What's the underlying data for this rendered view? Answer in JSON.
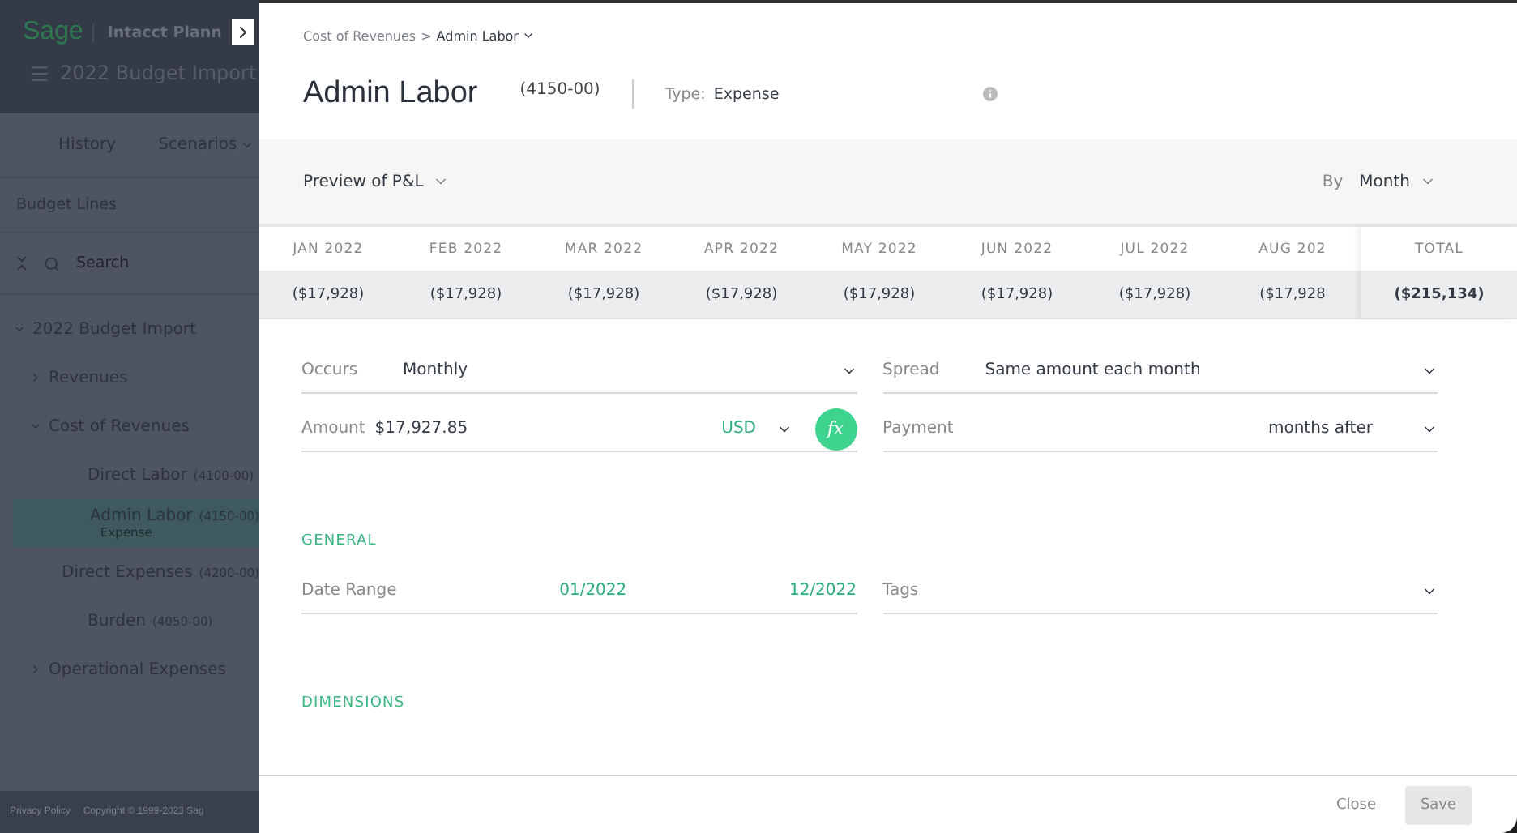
{
  "sidebar": {
    "logo": "Sage",
    "product": "Intacct Plann",
    "plan_title": "2022 Budget Import",
    "tabs": [
      {
        "label": "History",
        "selected": false,
        "has_menu": false
      },
      {
        "label": "Scenarios",
        "selected": false,
        "has_menu": true
      }
    ],
    "section_title": "Budget Lines",
    "search": {
      "placeholder": "Search"
    },
    "tree": [
      {
        "label": "2022 Budget Import",
        "expanded": true,
        "children": [
          {
            "label": "Revenues",
            "expanded": false
          },
          {
            "label": "Cost of Revenues",
            "expanded": true,
            "children": [
              {
                "label": "Direct Labor",
                "code": "(4100-00)",
                "selected": false
              },
              {
                "label": "Admin Labor",
                "code": "(4150-00)",
                "subtitle": "Expense",
                "selected": true
              },
              {
                "label": "Direct Expenses",
                "code": "(4200-00)",
                "selected": false
              },
              {
                "label": "Burden",
                "code": "(4050-00)",
                "selected": false
              }
            ]
          },
          {
            "label": "Operational Expenses",
            "expanded": false
          }
        ]
      }
    ],
    "footer": [
      "Privacy Policy",
      "Copyright © 1999-2023 Sag"
    ]
  },
  "panel": {
    "breadcrumb": {
      "parent": "Cost of Revenues",
      "separator": ">",
      "current": "Admin Labor"
    },
    "title": "Admin Labor",
    "code": "(4150-00)",
    "type_label": "Type:",
    "type_value": "Expense",
    "preview": {
      "label": "Preview of P&L",
      "by_label": "By",
      "by_value": "Month"
    },
    "table": {
      "columns": [
        "JAN 2022",
        "FEB 2022",
        "MAR 2022",
        "APR 2022",
        "MAY 2022",
        "JUN 2022",
        "JUL 2022",
        "AUG 202"
      ],
      "values": [
        "($17,928)",
        "($17,928)",
        "($17,928)",
        "($17,928)",
        "($17,928)",
        "($17,928)",
        "($17,928)",
        "($17,928"
      ],
      "total_label": "TOTAL",
      "total_value": "($215,134)"
    },
    "fields": [
      {
        "kind": "select",
        "label": "Occurs",
        "value": "Monthly"
      },
      {
        "kind": "select",
        "label": "Spread",
        "value": "Same amount each month"
      },
      {
        "kind": "amount",
        "label": "Amount",
        "value": "$17,927.85",
        "currency": "USD",
        "formula_label": "fx"
      },
      {
        "kind": "trailing",
        "label": "Payment",
        "value": "months after"
      }
    ],
    "sections": [
      {
        "title": "GENERAL",
        "fields": [
          {
            "kind": "range",
            "label": "Date Range",
            "start": "01/2022",
            "end": "12/2022"
          },
          {
            "kind": "select",
            "label": "Tags"
          }
        ]
      },
      {
        "title": "DIMENSIONS"
      }
    ],
    "footer": {
      "close": "Close",
      "save": "Save",
      "save_disabled": true
    }
  }
}
